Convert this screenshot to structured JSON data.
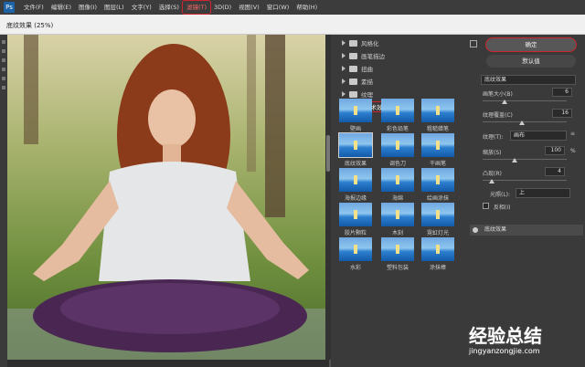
{
  "menubar": {
    "logo": "Ps",
    "items": [
      "文件(F)",
      "编辑(E)",
      "图像(I)",
      "图层(L)",
      "文字(Y)",
      "选择(S)",
      "滤镜(T)",
      "3D(D)",
      "视图(V)",
      "窗口(W)",
      "帮助(H)"
    ],
    "active_index": 6
  },
  "dialog": {
    "title": "底纹效果 (25%)"
  },
  "filter_gallery": {
    "folders": [
      "风格化",
      "画笔描边",
      "扭曲",
      "素描",
      "纹理"
    ],
    "open_folder": "艺术效果",
    "thumbnails": [
      "壁画",
      "彩色铅笔",
      "粗糙蜡笔",
      "底纹效果",
      "调色刀",
      "干画笔",
      "海报边缘",
      "海绵",
      "绘画涂抹",
      "胶片颗粒",
      "木刻",
      "霓虹灯光",
      "水彩",
      "塑料包装",
      "涂抹棒"
    ],
    "selected_thumbnail": "底纹效果"
  },
  "controls": {
    "ok_label": "确定",
    "default_label": "默认值",
    "filter_select": "底纹效果",
    "brush_size_label": "画笔大小(B)",
    "brush_size_value": "6",
    "texture_coverage_label": "纹理覆盖(C)",
    "texture_coverage_value": "16",
    "texture_label": "纹理(T):",
    "texture_value": "画布",
    "scaling_label": "缩放(S)",
    "scaling_value": "100",
    "scaling_unit": "%",
    "relief_label": "凸现(R)",
    "relief_value": "4",
    "light_label": "光照(L):",
    "light_value": "上",
    "invert_label": "反相(I)",
    "invert_checked": false
  },
  "layers": {
    "effect_layer": "底纹效果"
  },
  "watermark": {
    "brand": "经验总结",
    "url": "jingyanzongjie.com"
  }
}
